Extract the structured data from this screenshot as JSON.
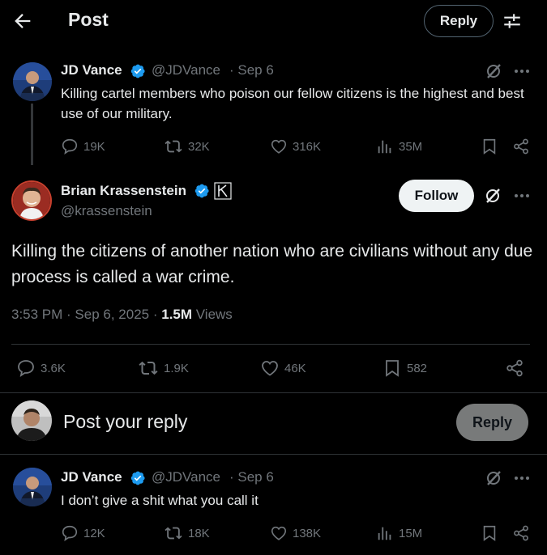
{
  "header": {
    "title": "Post",
    "reply_label": "Reply"
  },
  "parent_post": {
    "name": "JD Vance",
    "handle": "@JDVance",
    "date": "· Sep 6",
    "text": "Killing cartel members who poison our fellow citizens is the highest and best use of our military.",
    "replies": "19K",
    "reposts": "32K",
    "likes": "316K",
    "views": "35M"
  },
  "main_post": {
    "name": "Brian Krassenstein",
    "handle": "@krassenstein",
    "follow_label": "Follow",
    "text": "Killing the citizens of another nation who are civilians without any due process is called a war crime.",
    "time": "3:53 PM · Sep 6, 2025 ·",
    "views_count": "1.5M",
    "views_label": "Views",
    "replies": "3.6K",
    "reposts": "1.9K",
    "likes": "46K",
    "bookmarks": "582"
  },
  "composer": {
    "placeholder": "Post your reply",
    "reply_label": "Reply"
  },
  "reply_post": {
    "name": "JD Vance",
    "handle": "@JDVance",
    "date": "· Sep 6",
    "text": "I don’t give a shit what you call it",
    "replies": "12K",
    "reposts": "18K",
    "likes": "138K",
    "views": "15M"
  },
  "colors": {
    "background": "#000000",
    "verified": "#1d9bf0",
    "muted": "#71767b",
    "divider": "#2f3336"
  }
}
